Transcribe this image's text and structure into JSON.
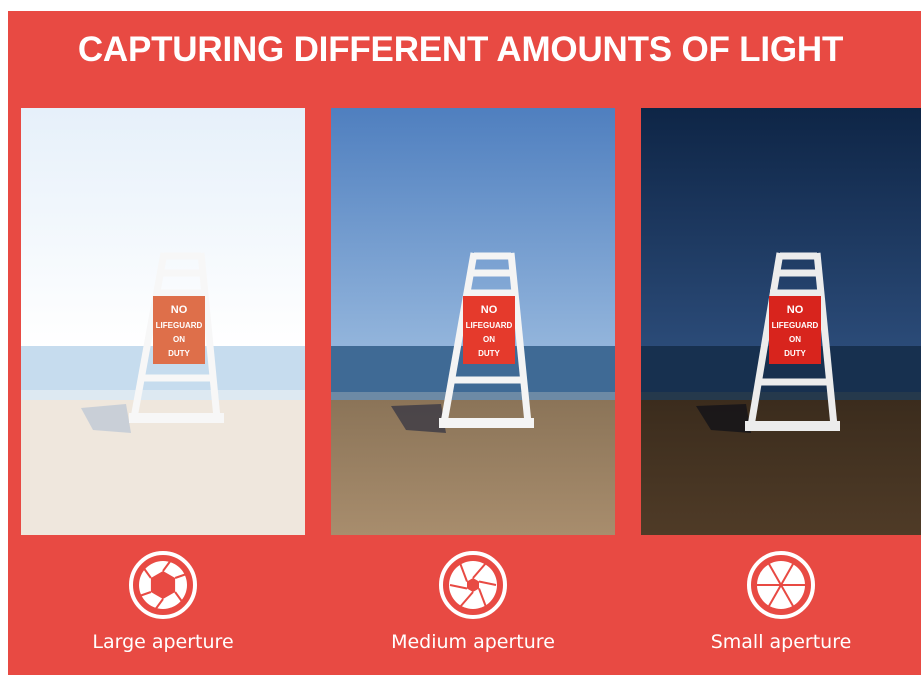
{
  "title": "CAPTURING DIFFERENT AMOUNTS OF LIGHT",
  "panels": [
    {
      "caption": "Large aperture",
      "sign": [
        "NO",
        "LIFEGUARD",
        "ON",
        "DUTY"
      ]
    },
    {
      "caption": "Medium aperture",
      "sign": [
        "NO",
        "LIFEGUARD",
        "ON",
        "DUTY"
      ]
    },
    {
      "caption": "Small aperture",
      "sign": [
        "NO",
        "LIFEGUARD",
        "ON",
        "DUTY"
      ]
    }
  ],
  "colors": {
    "background": "#e84a43",
    "text": "#ffffff"
  },
  "icons": [
    "aperture-large-icon",
    "aperture-medium-icon",
    "aperture-small-icon"
  ]
}
